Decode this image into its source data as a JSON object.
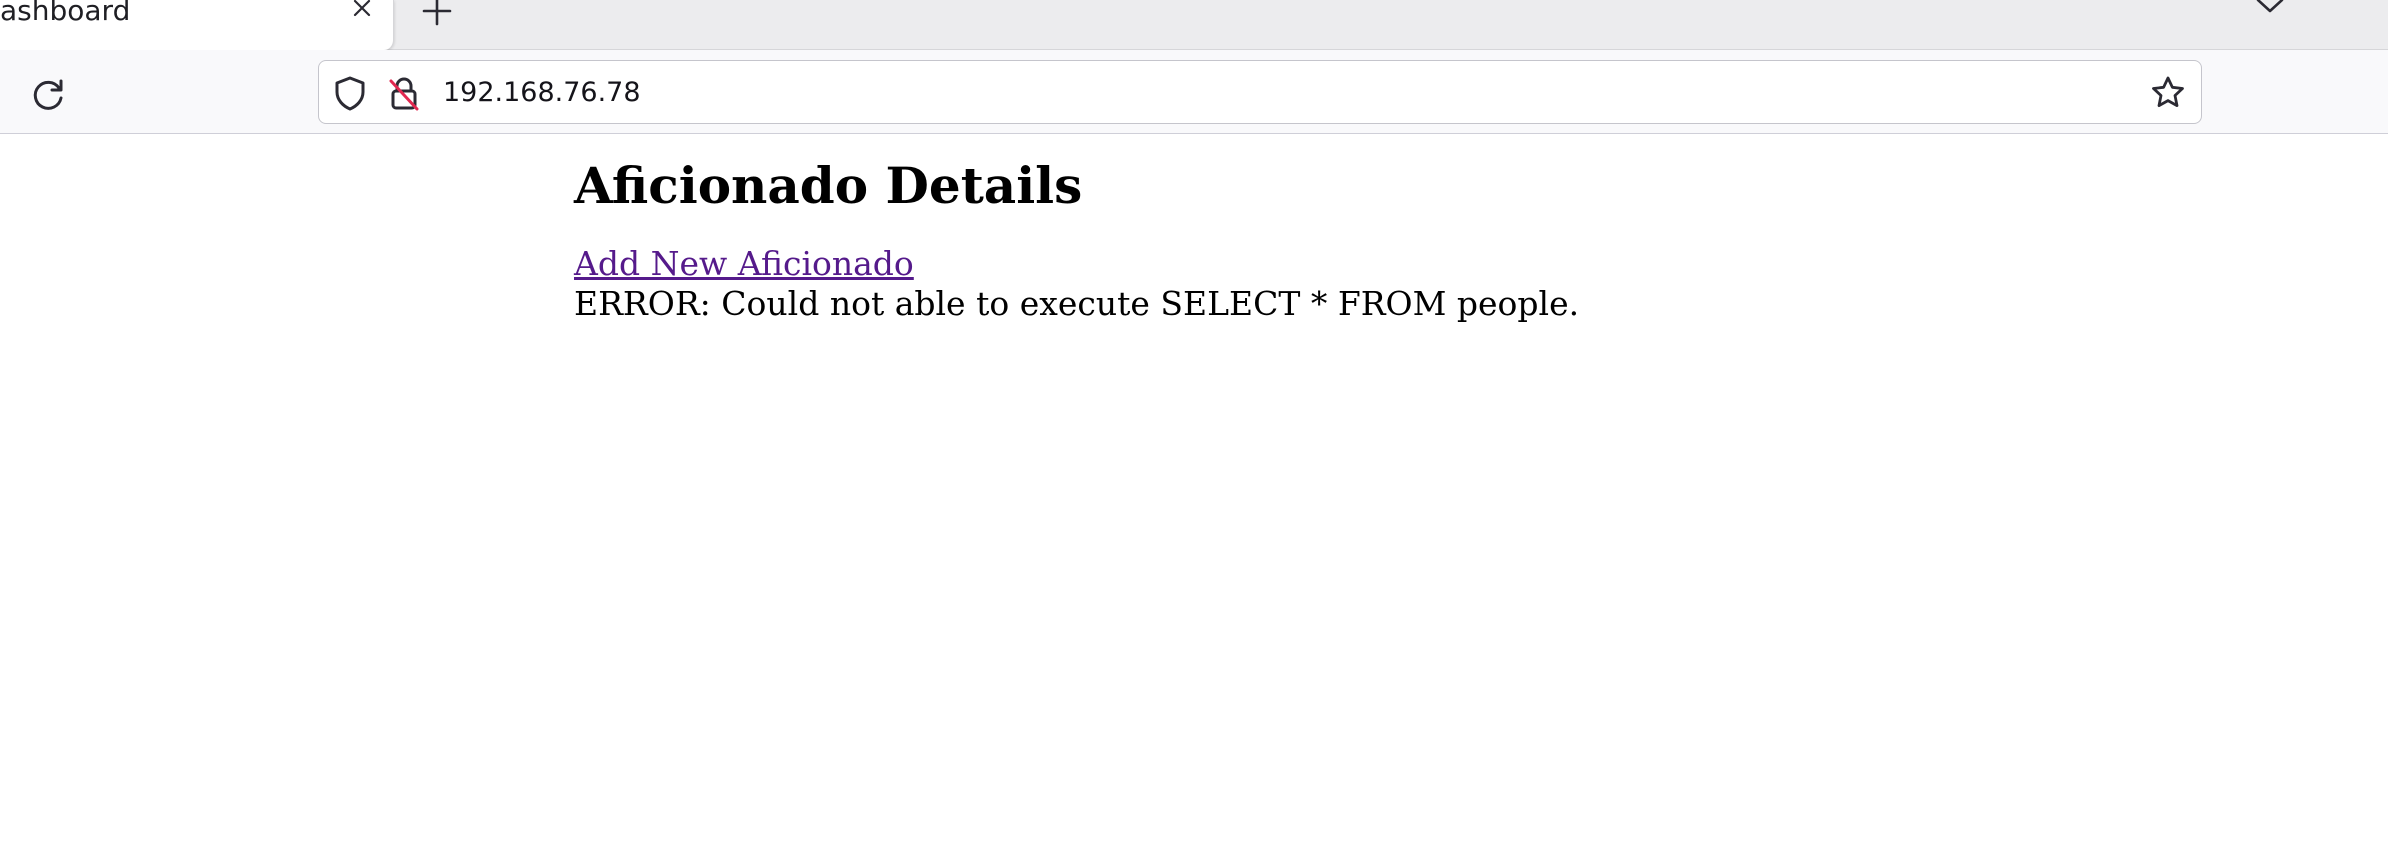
{
  "browser": {
    "tab": {
      "title": "ashboard"
    },
    "address_bar": {
      "url": "192.168.76.78"
    },
    "icons": {
      "tab_close": "close-icon",
      "new_tab": "plus-icon",
      "tab_list": "chevron-down-icon",
      "reload": "reload-icon",
      "tracking_protection": "shield-icon",
      "connection": "insecure-lock-icon",
      "bookmark": "star-icon"
    }
  },
  "page": {
    "title": "Aficionado Details",
    "add_link": "Add New Aficionado",
    "error_message": "ERROR: Could not able to execute SELECT * FROM people."
  },
  "colors": {
    "link_visited": "#551a8b",
    "insecure_slash": "#e22850",
    "tab_strip": "#ececee",
    "toolbar": "#f9f9fb"
  }
}
